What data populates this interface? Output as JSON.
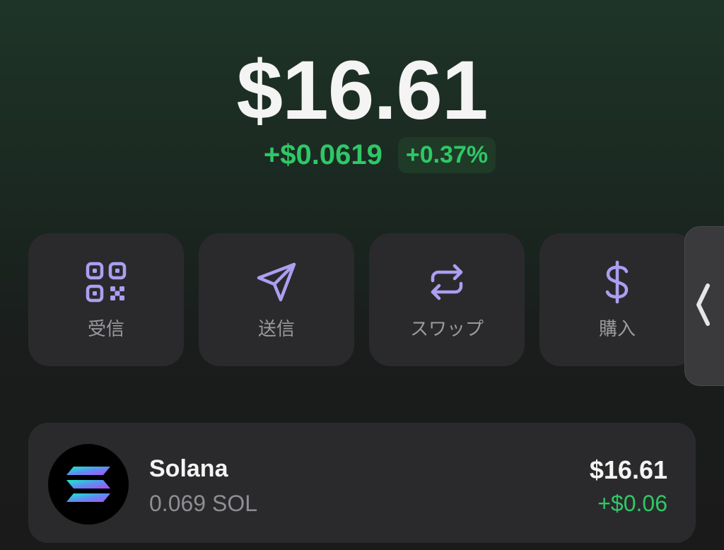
{
  "balance": {
    "total": "$16.61",
    "change_amount": "+$0.0619",
    "change_percent": "+0.37%"
  },
  "actions": [
    {
      "label": "受信",
      "icon": "qr-code-icon"
    },
    {
      "label": "送信",
      "icon": "send-icon"
    },
    {
      "label": "スワップ",
      "icon": "swap-icon"
    },
    {
      "label": "購入",
      "icon": "dollar-icon"
    }
  ],
  "tokens": [
    {
      "name": "Solana",
      "amount": "0.069 SOL",
      "value": "$16.61",
      "change": "+$0.06",
      "icon": "solana-logo"
    }
  ],
  "colors": {
    "positive": "#2ec866",
    "accent": "#ab9ff2",
    "card": "#2a2a2c"
  }
}
